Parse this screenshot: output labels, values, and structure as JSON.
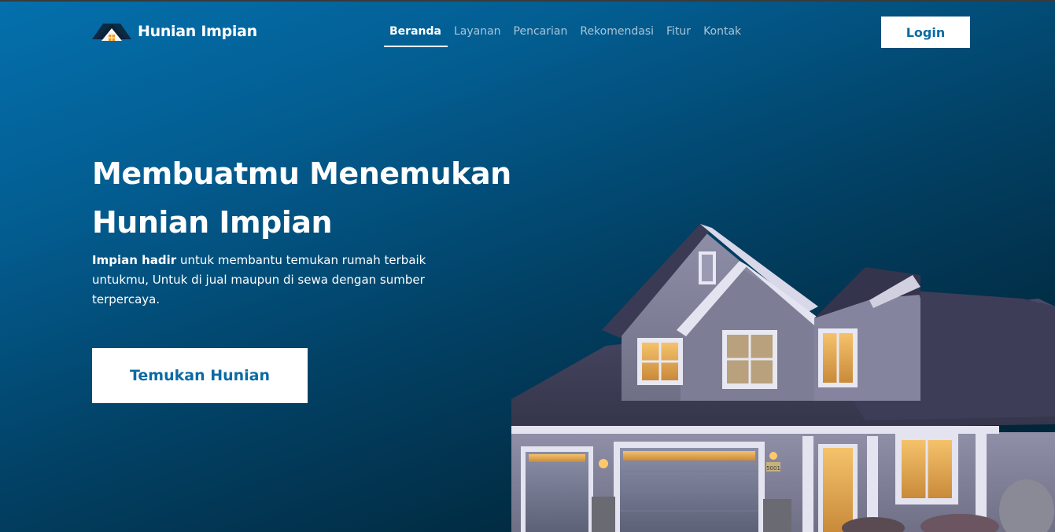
{
  "brand": {
    "name": "Hunian Impian",
    "logo_icon": "house-roof-icon"
  },
  "nav": {
    "items": [
      {
        "label": "Beranda",
        "active": true
      },
      {
        "label": "Layanan",
        "active": false
      },
      {
        "label": "Pencarian",
        "active": false
      },
      {
        "label": "Rekomendasi",
        "active": false
      },
      {
        "label": "Fitur",
        "active": false
      },
      {
        "label": "Kontak",
        "active": false
      }
    ],
    "login_label": "Login"
  },
  "hero": {
    "headline_line1": "Membuatmu Menemukan",
    "headline_line2": "Hunian Impian",
    "sub_strong": "Impian hadir",
    "sub_text": " untuk membantu temukan rumah terbaik untukmu, Untuk di jual maupun di sewa dengan sumber terpercaya.",
    "cta_label": "Temukan Hunian",
    "house_number": "5001"
  },
  "colors": {
    "accent": "#0b6aa3",
    "gradient_top": "#0470ad",
    "gradient_bottom": "#011e30",
    "nav_inactive": "#a9c6d8"
  }
}
